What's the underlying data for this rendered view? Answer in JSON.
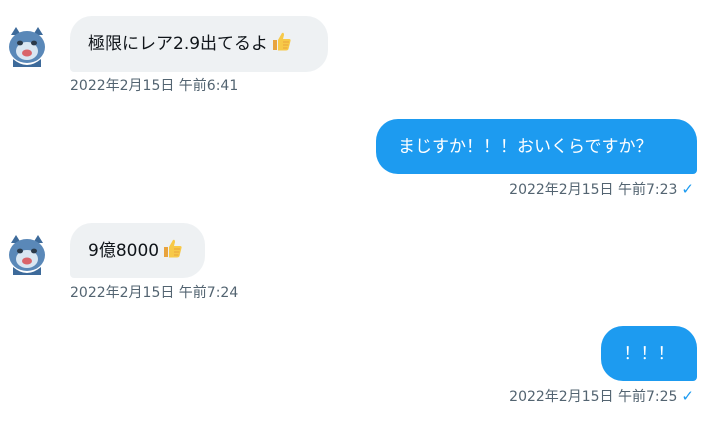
{
  "colors": {
    "incoming_bubble": "#eef1f3",
    "outgoing_bubble": "#1d9bf0",
    "timestamp": "#536471",
    "read_check": "#1d9bf0"
  },
  "messages": [
    {
      "direction": "incoming",
      "text": "極限にレア2.9出てるよ",
      "emoji": "thumbs-up-icon",
      "time": "2022年2月15日 午前6:41"
    },
    {
      "direction": "outgoing",
      "text": "まじすか！！！おいくらですか？",
      "time": "2022年2月15日 午前7:23",
      "status": "✓"
    },
    {
      "direction": "incoming",
      "text": "9億8000",
      "emoji": "thumbs-up-icon",
      "time": "2022年2月15日 午前7:24"
    },
    {
      "direction": "outgoing",
      "text": "！！！",
      "time": "2022年2月15日 午前7:25",
      "status": "✓"
    }
  ]
}
